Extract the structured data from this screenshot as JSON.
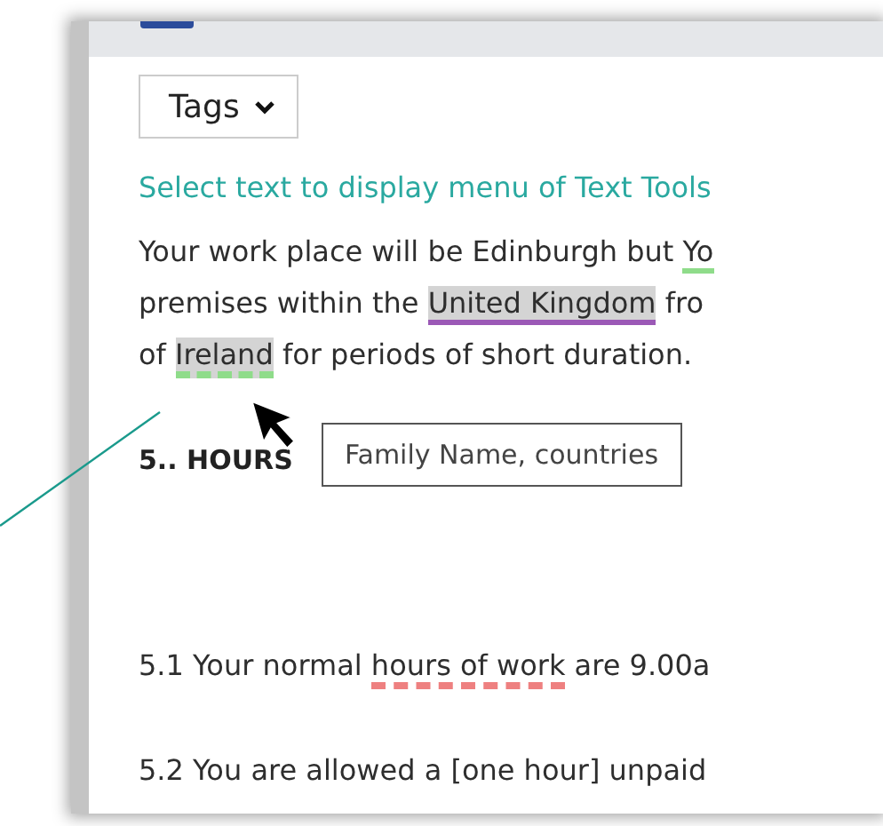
{
  "tags_dropdown": {
    "label": "Tags"
  },
  "hint": "Select text to display menu of Text Tools",
  "paragraph": [
    [
      {
        "text": "Your work place will be Edinburgh but ",
        "highlighted": false,
        "underlined": false
      },
      {
        "text": "Yo",
        "highlighted": false,
        "underlined": true,
        "dashed": false,
        "color": "#8fdc8a"
      }
    ],
    [
      {
        "text": "premises within the ",
        "highlighted": false,
        "underlined": false
      },
      {
        "text": "United Kingdom",
        "highlighted": true,
        "underlined": true,
        "dashed": false,
        "color": "#9b59b6"
      },
      {
        "text": " fro",
        "highlighted": false,
        "underlined": false
      }
    ],
    [
      {
        "text": "of ",
        "highlighted": false,
        "underlined": false
      },
      {
        "text": "Ireland",
        "highlighted": true,
        "underlined": true,
        "dashed": true,
        "color": "#8fdc8a"
      },
      {
        "text": " for periods of short duration.",
        "highlighted": false,
        "underlined": false
      }
    ]
  ],
  "heading": "5.. HOURS",
  "tooltip": "Family Name, countries",
  "clauses": [
    [
      {
        "text": "5.1 Your normal ",
        "highlighted": false,
        "underlined": false
      },
      {
        "text": "hours of work",
        "highlighted": false,
        "underlined": true,
        "dashed": true,
        "color": "#ee8080"
      },
      {
        "text": " are 9.00a",
        "highlighted": false,
        "underlined": false
      }
    ],
    [
      {
        "text": "5.2 You are allowed a [one hour] unpaid",
        "highlighted": false,
        "underlined": false
      }
    ]
  ]
}
